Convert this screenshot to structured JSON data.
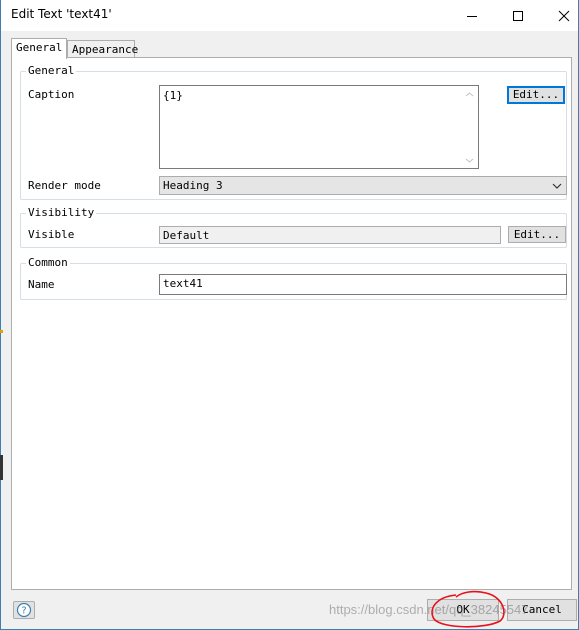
{
  "window": {
    "title": "Edit Text 'text41'"
  },
  "tabs": [
    {
      "label": "General",
      "active": true
    },
    {
      "label": "Appearance",
      "active": false
    }
  ],
  "general_group": {
    "title": "General",
    "caption_label": "Caption",
    "caption_value": "{1}",
    "caption_edit_button": "Edit...",
    "render_mode_label": "Render mode",
    "render_mode_value": "Heading 3"
  },
  "visibility_group": {
    "title": "Visibility",
    "visible_label": "Visible",
    "visible_value": "Default",
    "visible_edit_button": "Edit..."
  },
  "common_group": {
    "title": "Common",
    "name_label": "Name",
    "name_value": "text41"
  },
  "footer": {
    "ok_label": "OK",
    "cancel_label": "Cancel",
    "help_icon": "help-icon",
    "watermark": "https://blog.csdn.net/qq_38245547"
  },
  "colors": {
    "window_border": "#3c7fb1",
    "dialog_bg": "#f0f0f0",
    "default_button_border": "#0078d7",
    "annotation_red": "#e8101a"
  }
}
